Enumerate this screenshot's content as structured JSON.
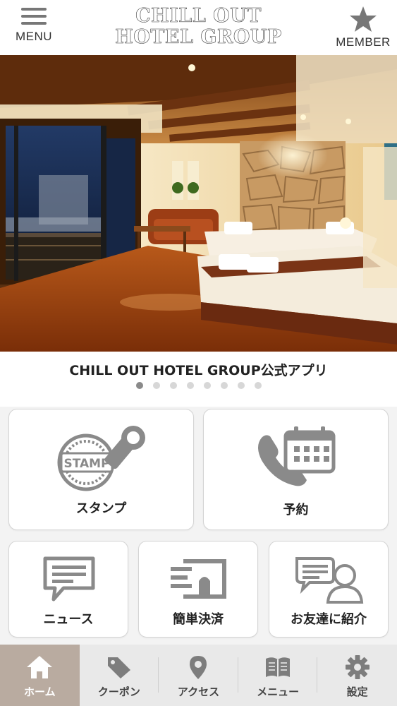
{
  "header": {
    "menu_label": "MENU",
    "member_label": "MEMBER",
    "logo_line1": "CHILL OUT",
    "logo_line2": "HOTEL GROUP"
  },
  "carousel": {
    "caption": "CHILL OUT HOTEL GROUP公式アプリ",
    "page_count": 8,
    "active_index": 0
  },
  "cards": {
    "stamp": {
      "label": "スタンプ",
      "icon": "stamp-icon",
      "stamp_text": "STAMP"
    },
    "reservation": {
      "label": "予約",
      "icon": "phone-calendar-icon"
    },
    "news": {
      "label": "ニュース",
      "icon": "news-icon"
    },
    "payment": {
      "label": "簡単決済",
      "icon": "payment-icon"
    },
    "invite": {
      "label": "お友達に紹介",
      "icon": "invite-friend-icon"
    }
  },
  "tabbar": {
    "items": [
      {
        "label": "ホーム",
        "icon": "home-icon",
        "active": true
      },
      {
        "label": "クーポン",
        "icon": "coupon-tag-icon",
        "active": false
      },
      {
        "label": "アクセス",
        "icon": "map-pin-icon",
        "active": false
      },
      {
        "label": "メニュー",
        "icon": "book-icon",
        "active": false
      },
      {
        "label": "設定",
        "icon": "gear-icon",
        "active": false
      }
    ]
  },
  "colors": {
    "icon_gray": "#8a8a8a",
    "tab_active_bg": "#b9aba0",
    "tabbar_bg": "#e9e9e9",
    "card_border": "#d4d4d4"
  }
}
